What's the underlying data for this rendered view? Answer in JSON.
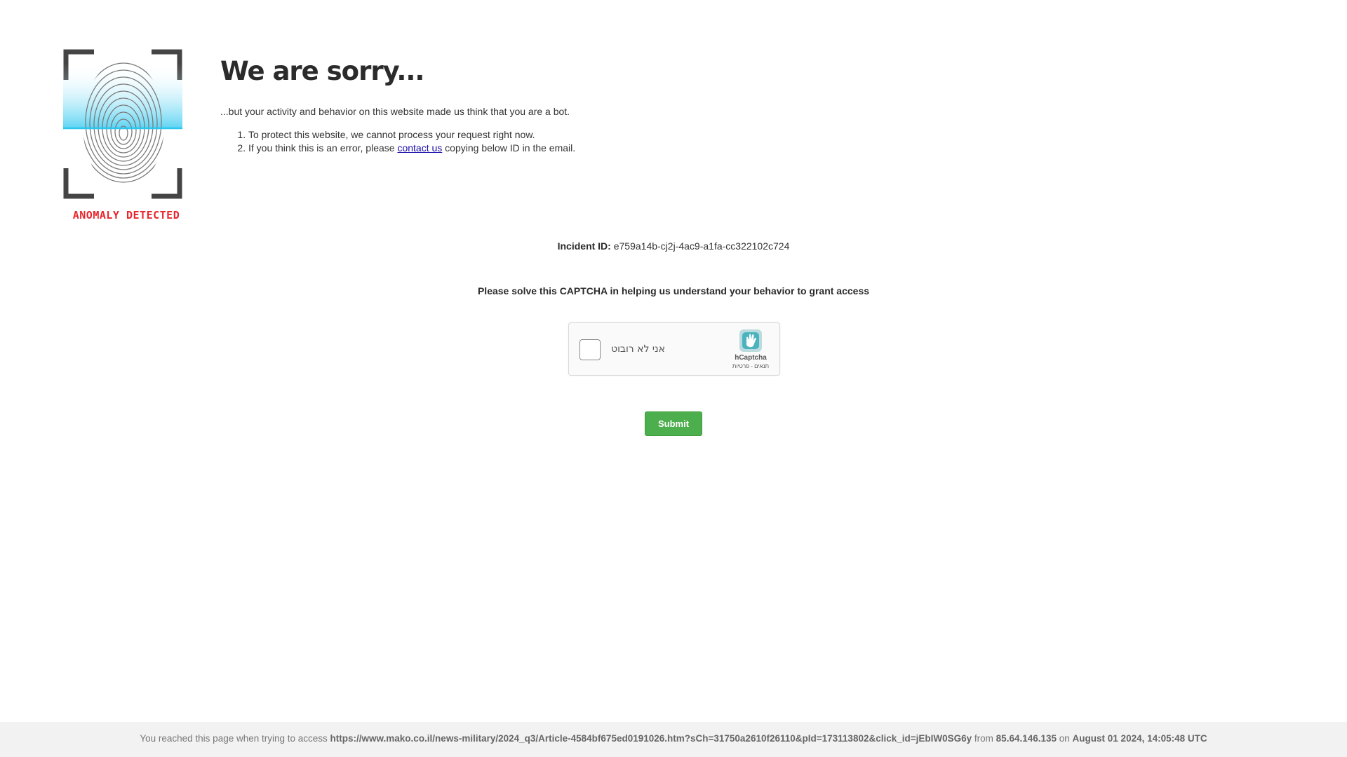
{
  "logo": {
    "caption": "ANOMALY DETECTED",
    "icon": "fingerprint-scan-icon",
    "accent_color": "#e8262d",
    "scan_color": "#29c6ef"
  },
  "heading": {
    "title": "We are sorry...",
    "intro": "...but your activity and behavior on this website made us think that you are a bot."
  },
  "reasons": {
    "item1": "To protect this website, we cannot process your request right now.",
    "item2_before": "If you think this is an error, please ",
    "item2_link": "contact us",
    "item2_after": " copying below ID in the email."
  },
  "incident": {
    "label": "Incident ID:",
    "value": "e759a14b-cj2j-4ac9-a1fa-cc322102c724"
  },
  "instruction": "Please solve this CAPTCHA in helping us understand your behavior to grant access",
  "captcha": {
    "label": "אני לא רובוט",
    "brand": "hCaptcha",
    "links": "תנאים - פרטיות",
    "brand_color": "#00838f"
  },
  "submit_label": "Submit",
  "submit_color": "#4cae4c",
  "footer": {
    "prefix": "You reached this page when trying to access ",
    "url": "https://www.mako.co.il/news-military/2024_q3/Article-4584bf675ed0191026.htm?sCh=31750a2610f26110&pId=173113802&click_id=jEbIW0SG6y",
    "from_text": " from ",
    "ip": "85.64.146.135",
    "on_text": " on ",
    "datetime": "August 01 2024, 14:05:48 UTC"
  }
}
